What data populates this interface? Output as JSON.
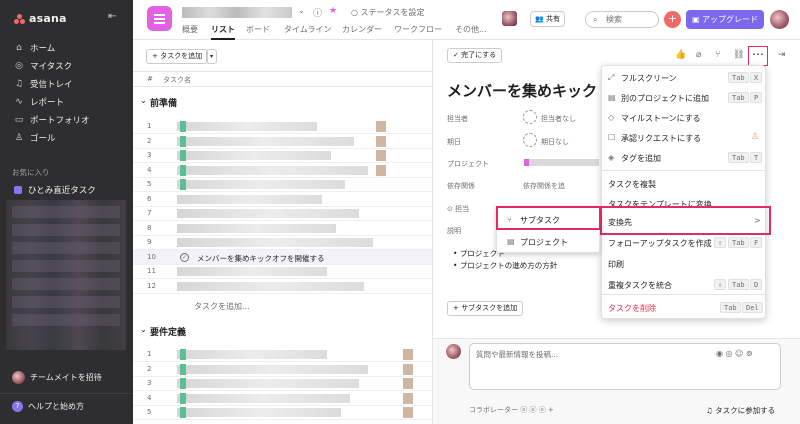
{
  "app": {
    "name": "asana"
  },
  "sidebar": {
    "items": [
      {
        "label": "ホーム",
        "icon": "home-icon"
      },
      {
        "label": "マイタスク",
        "icon": "check-circle-icon"
      },
      {
        "label": "受信トレイ",
        "icon": "bell-icon"
      },
      {
        "label": "レポート",
        "icon": "chart-line-icon"
      },
      {
        "label": "ポートフォリオ",
        "icon": "folder-icon"
      },
      {
        "label": "ゴール",
        "icon": "person-icon"
      }
    ],
    "favorites_title": "お気に入り",
    "favorites": [
      {
        "label": "ひとみ直近タスク"
      }
    ],
    "invite": "チームメイトを招待",
    "help": "ヘルプと始め方"
  },
  "topbar": {
    "tabs": [
      "概要",
      "リスト",
      "ボード",
      "タイムライン",
      "カレンダー",
      "ワークフロー",
      "その他..."
    ],
    "active_tab": "リスト",
    "status": "ステータスを設定",
    "share": "共有",
    "search_placeholder": "検索",
    "upgrade": "アップグレード"
  },
  "list": {
    "add_task": "+ タスクを追加",
    "col_num": "#",
    "col_name": "タスク名",
    "section1": "前準備",
    "section1_rows": [
      "1",
      "2",
      "3",
      "4",
      "5",
      "6",
      "7",
      "8",
      "9",
      "10",
      "11",
      "12"
    ],
    "highlight_row": {
      "num": "10",
      "text": "メンバーを集めキックオフを開催する"
    },
    "add_task_link": "タスクを追加...",
    "section2": "要件定義",
    "section2_rows": [
      "1",
      "2",
      "3",
      "4",
      "5"
    ]
  },
  "detail": {
    "complete": "✓ 完了にする",
    "title": "メンバーを集めキックオフを開催する",
    "fields": {
      "assignee_label": "担当者",
      "assignee_value": "担当者なし",
      "due_label": "期日",
      "due_value": "期日なし",
      "project_label": "プロジェクト",
      "deps_label": "依存関係",
      "deps_value": "依存関係を追",
      "assign_label": "担当",
      "desc_label": "説明"
    },
    "bullets": [
      "プロジェクト",
      "プロジェクトの進め方の方針"
    ],
    "add_subtask": "+ サブタスクを追加",
    "comment_placeholder": "質問や最新情報を投稿...",
    "collaborators": "コラボレーター",
    "join": "タスクに参加する"
  },
  "menu": {
    "items": [
      {
        "label": "フルスクリーン",
        "keys": [
          "Tab",
          "X"
        ]
      },
      {
        "label": "別のプロジェクトに追加",
        "keys": [
          "Tab",
          "P"
        ]
      },
      {
        "label": "マイルストーンにする",
        "keys": []
      },
      {
        "label": "承認リクエストにする",
        "keys": []
      },
      {
        "label": "タグを追加",
        "keys": [
          "Tab",
          "T"
        ]
      }
    ],
    "items2": [
      {
        "label": "タスクを複製",
        "keys": []
      },
      {
        "label": "タスクをテンプレートに変換",
        "keys": []
      },
      {
        "label": "変換先",
        "keys": [
          ">"
        ]
      },
      {
        "label": "フォローアップタスクを作成",
        "keys": [
          "⇧",
          "Tab",
          "F"
        ]
      },
      {
        "label": "印刷",
        "keys": []
      },
      {
        "label": "重複タスクを統合",
        "keys": [
          "⇧",
          "Tab",
          "D"
        ]
      }
    ],
    "delete": {
      "label": "タスクを削除",
      "keys": [
        "Tab",
        "Del"
      ]
    }
  },
  "submenu": {
    "items": [
      {
        "label": "サブタスク"
      },
      {
        "label": "プロジェクト"
      }
    ]
  },
  "colors": {
    "accent": "#e02a6a",
    "upgrade": "#7b68ee",
    "sidebar": "#2e2e30"
  }
}
